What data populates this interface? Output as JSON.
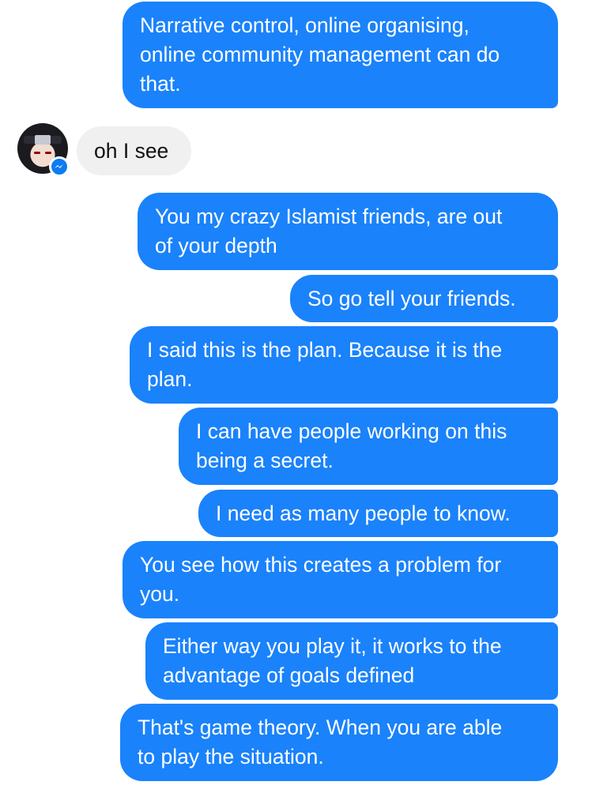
{
  "messages": [
    {
      "lines": [
        "Narrative control, online organising,",
        "online community management can do",
        "that."
      ]
    },
    {
      "lines": [
        "oh I see"
      ]
    },
    {
      "lines": [
        "You my crazy Islamist friends, are out",
        "of your depth"
      ]
    },
    {
      "lines": [
        "So go tell your friends."
      ]
    },
    {
      "lines": [
        "I said this is the plan. Because it is the",
        "plan."
      ]
    },
    {
      "lines": [
        "I can have people working on this",
        "being a secret."
      ]
    },
    {
      "lines": [
        "I need as many people to know."
      ]
    },
    {
      "lines": [
        "You see how this creates a problem for",
        "you."
      ]
    },
    {
      "lines": [
        "Either way you play it, it works to the",
        "advantage of goals defined"
      ]
    },
    {
      "lines": [
        "That's game theory. When you are able",
        "to play the situation."
      ]
    }
  ],
  "contact": {
    "avatar_icon": "ninja-avatar",
    "badge_icon": "messenger-icon"
  },
  "colors": {
    "outgoing_bubble": "#1a82fb",
    "incoming_bubble": "#f0f0f0",
    "background": "#ffffff"
  }
}
